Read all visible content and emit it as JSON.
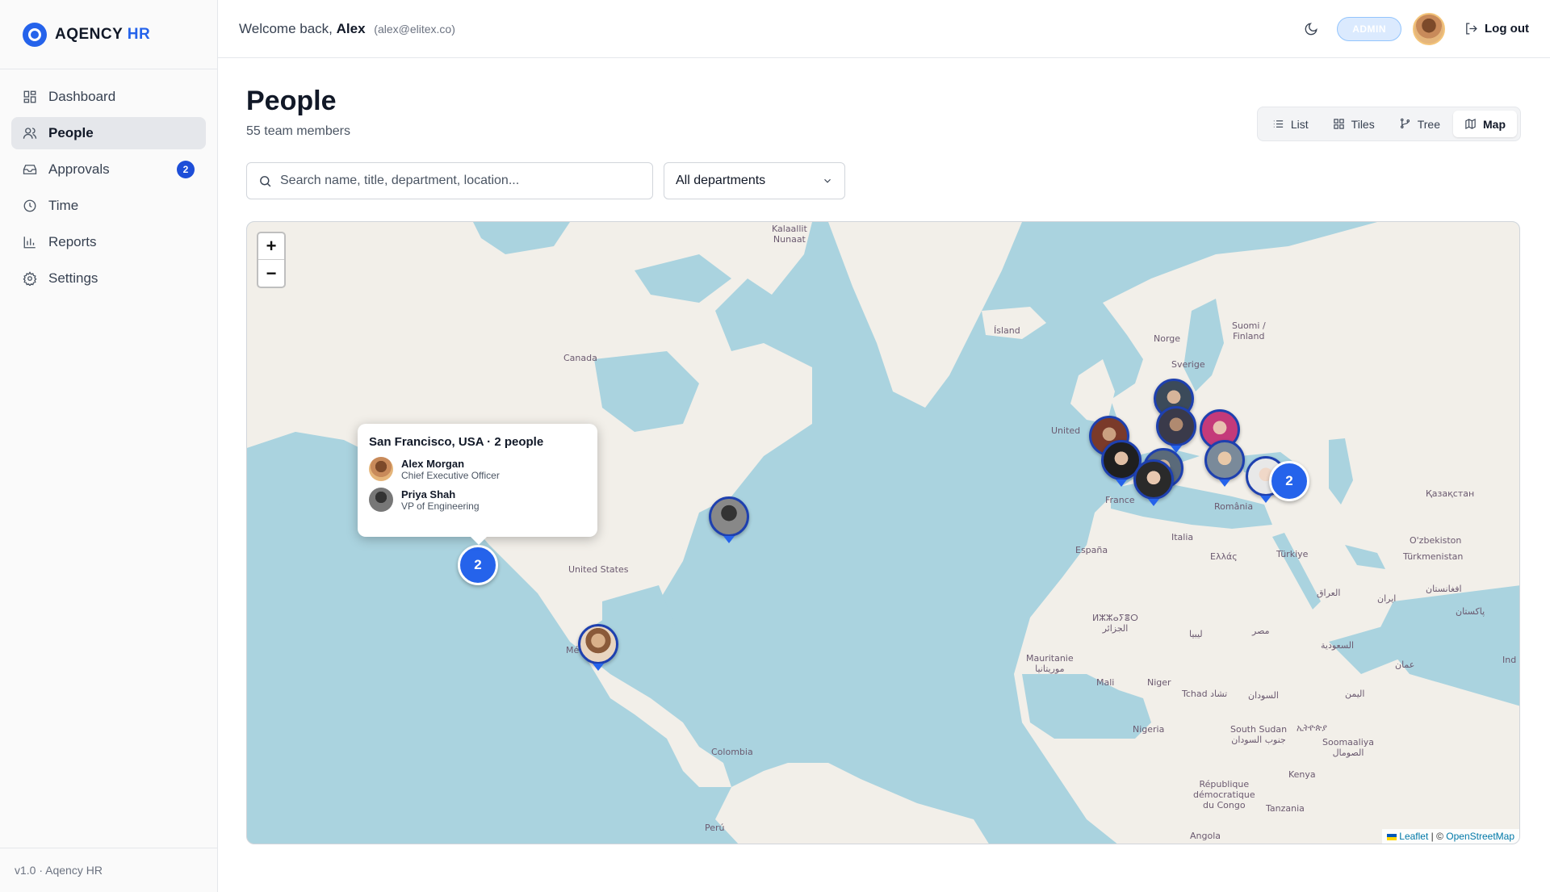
{
  "brand": {
    "name": "AQENCY",
    "suffix": "HR"
  },
  "sidebar": {
    "items": [
      {
        "label": "Dashboard",
        "icon": "dashboard-icon"
      },
      {
        "label": "People",
        "icon": "users-icon",
        "active": true
      },
      {
        "label": "Approvals",
        "icon": "inbox-icon",
        "badge": "2"
      },
      {
        "label": "Time",
        "icon": "clock-icon"
      },
      {
        "label": "Reports",
        "icon": "bar-chart-icon"
      },
      {
        "label": "Settings",
        "icon": "gear-icon"
      }
    ],
    "footer": "v1.0 · Aqency HR"
  },
  "header": {
    "welcome": "Welcome back,",
    "user_name": "Alex",
    "user_email": "(alex@elitex.co)",
    "role": "ADMIN",
    "logout_label": "Log out"
  },
  "main": {
    "title": "People",
    "subtitle": "55 team members",
    "views": [
      "List",
      "Tiles",
      "Tree",
      "Map"
    ],
    "active_view": "Map",
    "search_placeholder": "Search name, title, department, location...",
    "department_filter": "All departments"
  },
  "map": {
    "labels": {
      "kalaallit": "Kalaallit\nNunaat",
      "island": "Ísland",
      "norge": "Norge",
      "suomi": "Suomi /\nFinland",
      "sverige": "Sverige",
      "canada": "Canada",
      "united_kingdom": "United",
      "france": "France",
      "romania": "România",
      "kazakhstan": "Қазақстан",
      "espana": "España",
      "italia": "Italia",
      "ellas": "Ελλάς",
      "turkiye": "Türkiye",
      "uzbekistan": "O'zbekiston",
      "turkmenistan": "Türkmenistan",
      "united_states": "United States",
      "iraq": "العراق",
      "iran": "ایران",
      "afghanistan": "افغانستان",
      "pakistan": "پاکستان",
      "algeria": "ⵍⵣⵣⴰⵢⴻⵔ\nالجزائر",
      "libya": "ليبيا",
      "egypt": "مصر",
      "saudi": "السعودية",
      "india": "Ind",
      "oman": "عمان",
      "mauritanie": "Mauritanie\nموريتانيا",
      "mali": "Mali",
      "niger": "Niger",
      "tchad": "Tchad تشاد",
      "sudan": "السودان",
      "yemen": "اليمن",
      "mexico": "Mé",
      "nigeria": "Nigeria",
      "south_sudan": "South Sudan\nجنوب السودان",
      "ethiopia": "ኢትዮጵያ",
      "somalia": "Soomaaliya\nالصومال",
      "colombia": "Colombia",
      "kenya": "Kenya",
      "rdc": "République\ndémocratique\ndu Congo",
      "tanzania": "Tanzania",
      "peru": "Perú",
      "angola": "Angola"
    },
    "clusters": {
      "sf": "2",
      "black_sea": "2"
    },
    "zoom_in": "+",
    "zoom_out": "−",
    "attribution": {
      "leaflet": "Leaflet",
      "separator": " | © ",
      "osm": "OpenStreetMap"
    },
    "popup": {
      "title": "San Francisco, USA · 2 people",
      "people": [
        {
          "name": "Alex Morgan",
          "role": "Chief Executive Officer"
        },
        {
          "name": "Priya Shah",
          "role": "VP of Engineering"
        }
      ]
    }
  },
  "colors": {
    "accent": "#2563eb",
    "land": "#f2efe9",
    "water": "#aad3df"
  }
}
